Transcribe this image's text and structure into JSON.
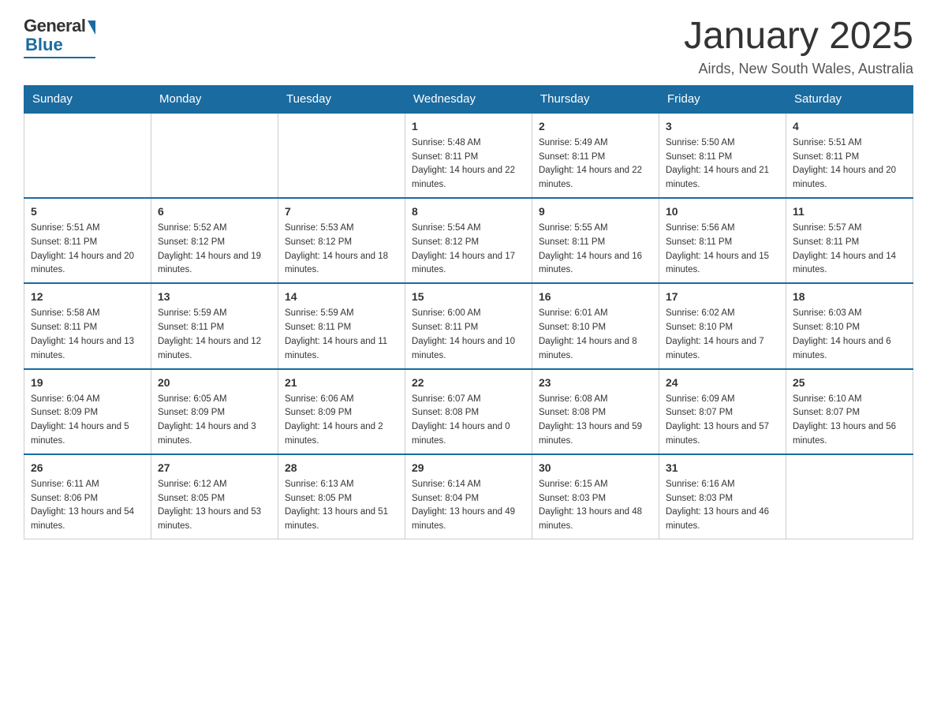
{
  "header": {
    "logo_general": "General",
    "logo_blue": "Blue",
    "month_title": "January 2025",
    "location": "Airds, New South Wales, Australia"
  },
  "days_of_week": [
    "Sunday",
    "Monday",
    "Tuesday",
    "Wednesday",
    "Thursday",
    "Friday",
    "Saturday"
  ],
  "weeks": [
    [
      {
        "day": "",
        "sunrise": "",
        "sunset": "",
        "daylight": ""
      },
      {
        "day": "",
        "sunrise": "",
        "sunset": "",
        "daylight": ""
      },
      {
        "day": "",
        "sunrise": "",
        "sunset": "",
        "daylight": ""
      },
      {
        "day": "1",
        "sunrise": "Sunrise: 5:48 AM",
        "sunset": "Sunset: 8:11 PM",
        "daylight": "Daylight: 14 hours and 22 minutes."
      },
      {
        "day": "2",
        "sunrise": "Sunrise: 5:49 AM",
        "sunset": "Sunset: 8:11 PM",
        "daylight": "Daylight: 14 hours and 22 minutes."
      },
      {
        "day": "3",
        "sunrise": "Sunrise: 5:50 AM",
        "sunset": "Sunset: 8:11 PM",
        "daylight": "Daylight: 14 hours and 21 minutes."
      },
      {
        "day": "4",
        "sunrise": "Sunrise: 5:51 AM",
        "sunset": "Sunset: 8:11 PM",
        "daylight": "Daylight: 14 hours and 20 minutes."
      }
    ],
    [
      {
        "day": "5",
        "sunrise": "Sunrise: 5:51 AM",
        "sunset": "Sunset: 8:11 PM",
        "daylight": "Daylight: 14 hours and 20 minutes."
      },
      {
        "day": "6",
        "sunrise": "Sunrise: 5:52 AM",
        "sunset": "Sunset: 8:12 PM",
        "daylight": "Daylight: 14 hours and 19 minutes."
      },
      {
        "day": "7",
        "sunrise": "Sunrise: 5:53 AM",
        "sunset": "Sunset: 8:12 PM",
        "daylight": "Daylight: 14 hours and 18 minutes."
      },
      {
        "day": "8",
        "sunrise": "Sunrise: 5:54 AM",
        "sunset": "Sunset: 8:12 PM",
        "daylight": "Daylight: 14 hours and 17 minutes."
      },
      {
        "day": "9",
        "sunrise": "Sunrise: 5:55 AM",
        "sunset": "Sunset: 8:11 PM",
        "daylight": "Daylight: 14 hours and 16 minutes."
      },
      {
        "day": "10",
        "sunrise": "Sunrise: 5:56 AM",
        "sunset": "Sunset: 8:11 PM",
        "daylight": "Daylight: 14 hours and 15 minutes."
      },
      {
        "day": "11",
        "sunrise": "Sunrise: 5:57 AM",
        "sunset": "Sunset: 8:11 PM",
        "daylight": "Daylight: 14 hours and 14 minutes."
      }
    ],
    [
      {
        "day": "12",
        "sunrise": "Sunrise: 5:58 AM",
        "sunset": "Sunset: 8:11 PM",
        "daylight": "Daylight: 14 hours and 13 minutes."
      },
      {
        "day": "13",
        "sunrise": "Sunrise: 5:59 AM",
        "sunset": "Sunset: 8:11 PM",
        "daylight": "Daylight: 14 hours and 12 minutes."
      },
      {
        "day": "14",
        "sunrise": "Sunrise: 5:59 AM",
        "sunset": "Sunset: 8:11 PM",
        "daylight": "Daylight: 14 hours and 11 minutes."
      },
      {
        "day": "15",
        "sunrise": "Sunrise: 6:00 AM",
        "sunset": "Sunset: 8:11 PM",
        "daylight": "Daylight: 14 hours and 10 minutes."
      },
      {
        "day": "16",
        "sunrise": "Sunrise: 6:01 AM",
        "sunset": "Sunset: 8:10 PM",
        "daylight": "Daylight: 14 hours and 8 minutes."
      },
      {
        "day": "17",
        "sunrise": "Sunrise: 6:02 AM",
        "sunset": "Sunset: 8:10 PM",
        "daylight": "Daylight: 14 hours and 7 minutes."
      },
      {
        "day": "18",
        "sunrise": "Sunrise: 6:03 AM",
        "sunset": "Sunset: 8:10 PM",
        "daylight": "Daylight: 14 hours and 6 minutes."
      }
    ],
    [
      {
        "day": "19",
        "sunrise": "Sunrise: 6:04 AM",
        "sunset": "Sunset: 8:09 PM",
        "daylight": "Daylight: 14 hours and 5 minutes."
      },
      {
        "day": "20",
        "sunrise": "Sunrise: 6:05 AM",
        "sunset": "Sunset: 8:09 PM",
        "daylight": "Daylight: 14 hours and 3 minutes."
      },
      {
        "day": "21",
        "sunrise": "Sunrise: 6:06 AM",
        "sunset": "Sunset: 8:09 PM",
        "daylight": "Daylight: 14 hours and 2 minutes."
      },
      {
        "day": "22",
        "sunrise": "Sunrise: 6:07 AM",
        "sunset": "Sunset: 8:08 PM",
        "daylight": "Daylight: 14 hours and 0 minutes."
      },
      {
        "day": "23",
        "sunrise": "Sunrise: 6:08 AM",
        "sunset": "Sunset: 8:08 PM",
        "daylight": "Daylight: 13 hours and 59 minutes."
      },
      {
        "day": "24",
        "sunrise": "Sunrise: 6:09 AM",
        "sunset": "Sunset: 8:07 PM",
        "daylight": "Daylight: 13 hours and 57 minutes."
      },
      {
        "day": "25",
        "sunrise": "Sunrise: 6:10 AM",
        "sunset": "Sunset: 8:07 PM",
        "daylight": "Daylight: 13 hours and 56 minutes."
      }
    ],
    [
      {
        "day": "26",
        "sunrise": "Sunrise: 6:11 AM",
        "sunset": "Sunset: 8:06 PM",
        "daylight": "Daylight: 13 hours and 54 minutes."
      },
      {
        "day": "27",
        "sunrise": "Sunrise: 6:12 AM",
        "sunset": "Sunset: 8:05 PM",
        "daylight": "Daylight: 13 hours and 53 minutes."
      },
      {
        "day": "28",
        "sunrise": "Sunrise: 6:13 AM",
        "sunset": "Sunset: 8:05 PM",
        "daylight": "Daylight: 13 hours and 51 minutes."
      },
      {
        "day": "29",
        "sunrise": "Sunrise: 6:14 AM",
        "sunset": "Sunset: 8:04 PM",
        "daylight": "Daylight: 13 hours and 49 minutes."
      },
      {
        "day": "30",
        "sunrise": "Sunrise: 6:15 AM",
        "sunset": "Sunset: 8:03 PM",
        "daylight": "Daylight: 13 hours and 48 minutes."
      },
      {
        "day": "31",
        "sunrise": "Sunrise: 6:16 AM",
        "sunset": "Sunset: 8:03 PM",
        "daylight": "Daylight: 13 hours and 46 minutes."
      },
      {
        "day": "",
        "sunrise": "",
        "sunset": "",
        "daylight": ""
      }
    ]
  ]
}
